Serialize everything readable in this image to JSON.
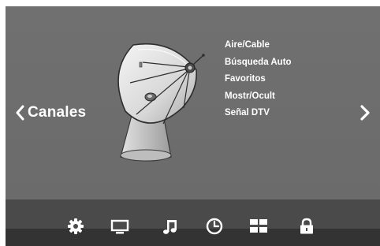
{
  "section": {
    "title": "Canales"
  },
  "menu": {
    "items": [
      "Aire/Cable",
      "Búsqueda Auto",
      "Favoritos",
      "Mostr/Ocult",
      "Señal DTV"
    ]
  },
  "toolbar": {
    "icons": [
      "gear-icon",
      "monitor-icon",
      "music-note-icon",
      "clock-icon",
      "grid-icon",
      "lock-icon"
    ],
    "selected": "gear-icon"
  },
  "colors": {
    "background": "#6d6d6d",
    "toolbar_top": "#4a4a4a",
    "toolbar_bottom": "#333333",
    "text": "#ffffff"
  }
}
